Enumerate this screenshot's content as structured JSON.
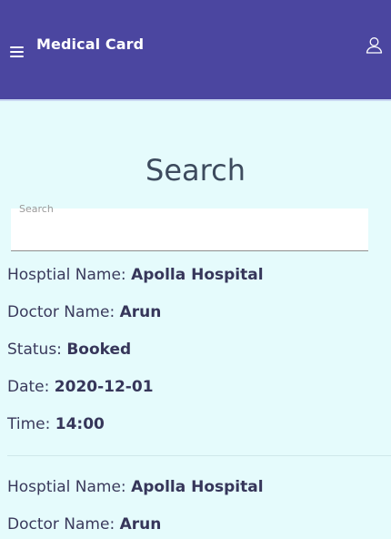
{
  "header": {
    "menu_icon": "hamburger-menu-icon",
    "title": "Medical Card",
    "user_icon": "user-profile-icon",
    "background_color": "#4b46a0"
  },
  "main": {
    "heading": "Search",
    "search": {
      "label": "Search",
      "value": "",
      "placeholder": ""
    },
    "records": [
      {
        "hospital_label": "Hosptial Name:",
        "hospital_value": "Apolla Hospital",
        "doctor_label": "Doctor Name:",
        "doctor_value": "Arun",
        "status_label": "Status:",
        "status_value": "Booked",
        "date_label": "Date:",
        "date_value": "2020-12-01",
        "time_label": "Time:",
        "time_value": "14:00"
      },
      {
        "hospital_label": "Hosptial Name:",
        "hospital_value": "Apolla Hospital",
        "doctor_label": "Doctor Name:",
        "doctor_value": "Arun"
      }
    ]
  }
}
